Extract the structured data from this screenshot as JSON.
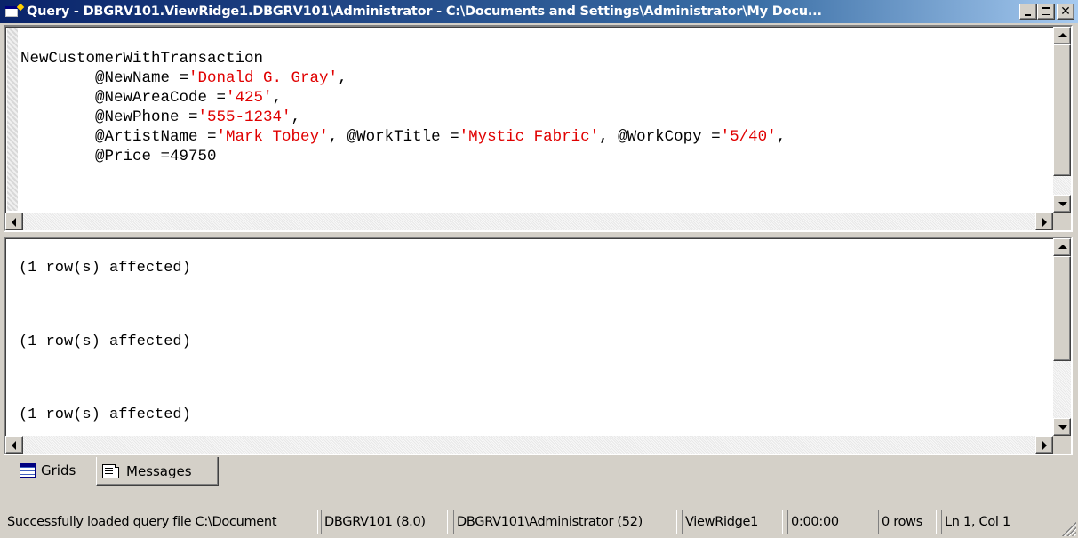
{
  "window": {
    "title": "Query - DBGRV101.ViewRidge1.DBGRV101\\Administrator - C:\\Documents and Settings\\Administrator\\My Docu..."
  },
  "editor": {
    "lines": [
      [
        {
          "t": "NewCustomerWithTransaction",
          "c": "plain"
        }
      ],
      [
        {
          "t": "        @NewName =",
          "c": "plain"
        },
        {
          "t": "'Donald G. Gray'",
          "c": "str"
        },
        {
          "t": ",",
          "c": "plain"
        }
      ],
      [
        {
          "t": "        @NewAreaCode =",
          "c": "plain"
        },
        {
          "t": "'425'",
          "c": "str"
        },
        {
          "t": ",",
          "c": "plain"
        }
      ],
      [
        {
          "t": "        @NewPhone =",
          "c": "plain"
        },
        {
          "t": "'555-1234'",
          "c": "str"
        },
        {
          "t": ",",
          "c": "plain"
        }
      ],
      [
        {
          "t": "        @ArtistName =",
          "c": "plain"
        },
        {
          "t": "'Mark Tobey'",
          "c": "str"
        },
        {
          "t": ", @WorkTitle =",
          "c": "plain"
        },
        {
          "t": "'Mystic Fabric'",
          "c": "str"
        },
        {
          "t": ", @WorkCopy =",
          "c": "plain"
        },
        {
          "t": "'5/40'",
          "c": "str"
        },
        {
          "t": ",",
          "c": "plain"
        }
      ],
      [
        {
          "t": "        @Price =49750",
          "c": "plain"
        }
      ]
    ]
  },
  "results": {
    "messages": [
      "(1 row(s) affected)",
      "(1 row(s) affected)",
      "(1 row(s) affected)"
    ]
  },
  "tabs": {
    "grids_label": "Grids",
    "messages_label": "Messages"
  },
  "status": {
    "message": "Successfully loaded query file C:\\Document",
    "server": "DBGRV101 (8.0)",
    "user": "DBGRV101\\Administrator (52)",
    "database": "ViewRidge1",
    "time": "0:00:00",
    "rows": "0 rows",
    "position": "Ln 1, Col 1"
  },
  "colors": {
    "string_literal": "#e00000",
    "title_bar": "#0a246a",
    "chrome": "#d4d0c8"
  },
  "icons": {
    "title": "query-window-icon",
    "grids_tab": "grid-icon",
    "messages_tab": "messages-icon"
  }
}
